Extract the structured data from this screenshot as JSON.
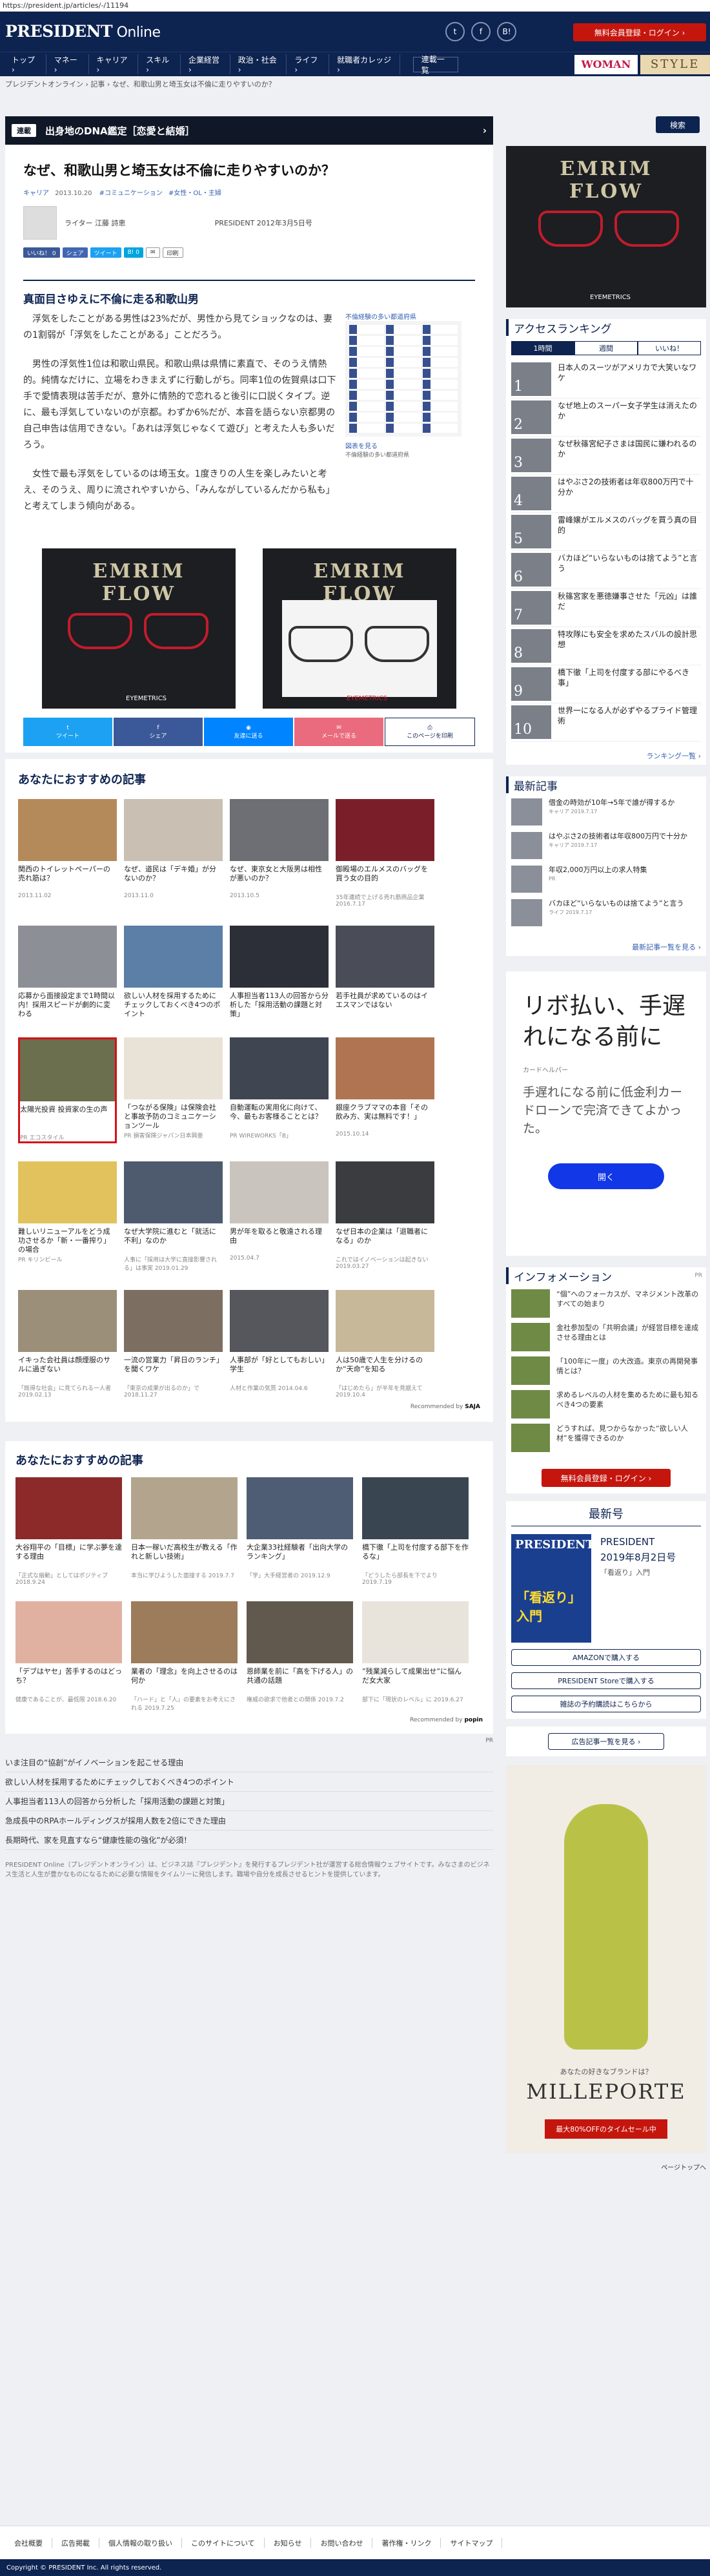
{
  "url": "https://president.jp/articles/-/11194",
  "header": {
    "logo_main": "PRESIDENT",
    "logo_sub": " Online",
    "sns": [
      "t",
      "f",
      "B!"
    ],
    "register": "無料会員登録・ログイン ›"
  },
  "nav": {
    "items": [
      "トップ ›",
      "マネー ›",
      "キャリア ›",
      "スキル ›",
      "企業経営 ›",
      "政治・社会 ›",
      "ライフ ›",
      "就職者カレッジ ›",
      "連載一覧"
    ],
    "brand_woman": "WOMAN",
    "brand_style": "STYLE"
  },
  "breadcrumb": "プレジデントオンライン ›  記事 › なぜ、和歌山男と埼玉女は不倫に走りやすいのか？",
  "series": {
    "tag": "連載",
    "title": "出身地のDNA鑑定［恋愛と結婚］"
  },
  "article": {
    "title": "なぜ、和歌山男と埼玉女は不倫に走りやすいのか？",
    "tags": [
      "キャリア",
      "2013.10.20",
      "#コミュニケーション",
      "#女性・OL・主婦"
    ],
    "author": "ライター 江藤 詩恵",
    "source": "PRESIDENT 2012年3月5日号",
    "share_buttons": [
      "いいね！ 0",
      "シェア",
      "ツイート",
      "B! 0",
      "印刷"
    ],
    "heading": "真面目さゆえに不倫に走る和歌山男",
    "paragraphs": [
      "浮気をしたことがある男性は23%だが、男性から見てショックなのは、妻の1割弱が「浮気をしたことがある」ことだろう。",
      "男性の浮気性1位は和歌山県民。和歌山県は県情に素直で、そのうえ情熱的。純情なだけに、立場をわきまえずに行動しがち。同率1位の佐賀県は口下手で愛情表現は苦手だが、意外に情熱的で恋れると後引に口説くタイプ。逆に、最も浮気していないのが京都。わずか6%だが、本音を語らない京都男の自己申告は信用できない。「あれは浮気じゃなくて遊び」と考えた人も多いだろう。",
      "女性で最も浮気をしているのは埼玉女。1度きりの人生を楽しみたいと考え、そのうえ、周りに流されやすいから、「みんながしているんだから私も」と考えてしまう傾向がある。"
    ],
    "map_title": "不倫経験の多い都道府県",
    "map_caption": "図表を見る",
    "map_caption2": "不倫経験の多い都道府県",
    "share_bar": [
      "ツイート",
      "シェア",
      "友達に送る",
      "メールで送る",
      "このページを印刷"
    ]
  },
  "ads": {
    "glasses_text": "EMRIM FLOW",
    "glasses_sub": "EYEMETRICS"
  },
  "recommend1": {
    "title": "あなたにおすすめの記事",
    "cards": [
      {
        "t": "関西のトイレットペーパーの売れ筋は？",
        "s": "2013.11.02"
      },
      {
        "t": "なぜ、道民は「デキ婚」が分ないのか？",
        "s": "2013.11.0"
      },
      {
        "t": "なぜ、東京女と大阪男は相性が悪いのか？",
        "s": "2013.10.5"
      },
      {
        "t": "御殿場のエルメスのバッグを買う女の目的",
        "s": "35年連続で上げる売れ筋商品企業 2016.7.17"
      },
      {
        "t": "応募から面接設定まで1時間以内！採用スピードが劇的に変わる",
        "s": ""
      },
      {
        "t": "欲しい人材を採用するためにチェックしておくべき4つのポイント",
        "s": ""
      },
      {
        "t": "人事担当者113人の回答から分析した「採用活動の課題と対策」",
        "s": ""
      },
      {
        "t": "若手社員が求めているのはイエスマンではない",
        "s": ""
      },
      {
        "t": "太陽光投資 投資家の生の声",
        "s": "PR エコスタイル"
      },
      {
        "t": "「つながる保険」は保険会社と事故予防のコミュニケーションツール",
        "s": "PR 損害保険ジャパン日本興亜"
      },
      {
        "t": "自動運転の実用化に向けて、今、最もお客様ることとは？",
        "s": "PR WIREWORKS「B」"
      },
      {
        "t": "銀座クラブママの本音「その飲み方、実は無料です！」",
        "s": "2015.10.14"
      },
      {
        "t": "難しいリニューアルをどう成功させるか「新・一番搾り」の場合",
        "s": "PR キリンビール"
      },
      {
        "t": "なぜ大学院に進むと「就活に不利」なのか",
        "s": "人事に「採用は大学に直接影響される」は事実 2019.01.29"
      },
      {
        "t": "男が年を取ると敬遠される理由",
        "s": "2015.04.7"
      },
      {
        "t": "なぜ日本の企業は「退職者になる」のか",
        "s": "これではイノベーションは起きない 2019.03.27"
      },
      {
        "t": "イキった会社員は顔煙服のサルに過ぎない",
        "s": "「既得な社会」に見てられる一人者 2019.02.13"
      },
      {
        "t": "一流の営業力「昇日のランチ」を聞くワケ",
        "s": "「東京の成果が出るのか」で 2018.11.27"
      },
      {
        "t": "人事部が「好としてもおしい」学生",
        "s": "人材と作業の気質 2014.04.6"
      },
      {
        "t": "人は50歳で人生を分けるのか“天命”を知る",
        "s": "「はじめたら」が半年を見据えて 2019.10.4"
      }
    ],
    "powered": "Recommended by"
  },
  "recommend2": {
    "title": "あなたにおすすめの記事",
    "cards": [
      {
        "t": "大谷翔平の「目標」に学ぶ夢を達する理由",
        "s": "「正式な扇動」としてはポジティブ 2018.9.24"
      },
      {
        "t": "日本一稼いだ高校生が教える「作れと新しい技術」",
        "s": "本当に学びようした面接する 2019.7.7"
      },
      {
        "t": "大企業33社経験者「出向大学のランキング」",
        "s": "「学」大手経営者の 2019.12.9"
      },
      {
        "t": "橋下徹「上司を付度する部下を作るな」",
        "s": "「どうしたら部長を下でより 2019.7.19"
      },
      {
        "t": "「デブはヤセ」苦手するのはどっち？",
        "s": "健康であることが、最低限 2018.6.20"
      },
      {
        "t": "業者の「理念」を向上させるのは何か",
        "s": "「ハード」と「人」の要素をお考えにされる 2019.7.25"
      },
      {
        "t": "恩師業を前に「高を下げる人」の共通の話題",
        "s": "権威の欲求で他者との関係 2019.7.2"
      },
      {
        "t": "”残業減らして成果出せ”に悩んだ女大家",
        "s": "部下に「現状のレベル」に 2019.6.27"
      }
    ],
    "powered": "Recommended by"
  },
  "links": [
    "いま注目の“協創”がイノベーションを起こせる理由",
    "欲しい人材を採用するためにチェックしておくべき4つのポイント",
    "人事担当者113人の回答から分析した「採用活動の課題と対策」",
    "急成長中のRPAホールディングスが採用人数を2倍にできた理由",
    "長期時代、家を見直すなら“健康性能の強化”が必須！"
  ],
  "footer_text": "PRESIDENT Online（プレジデントオンライン）は、ビジネス誌『プレジデント』を発行するプレジデント社が運営する総合情報ウェブサイトです。みなさまのビジネス生活と人生が豊かなものになるために必要な情報をタイムリーに発信します。職場や自分を成長させるヒントを提供しています。",
  "footer_nav": [
    "会社概要",
    "広告掲載",
    "個人情報の取り扱い",
    "このサイトについて",
    "お知らせ",
    "お問い合わせ",
    "著作権・リンク",
    "サイトマップ"
  ],
  "copyright": "Copyright © PRESIDENT Inc. All rights reserved.",
  "pagetop": "ページトップへ",
  "sidebar": {
    "search": "検索",
    "ranking_title": "アクセスランキング",
    "tabs": [
      "1時間",
      "週間",
      "いいね！"
    ],
    "ranking": [
      {
        "n": "1",
        "t": "日本人のスーツがアメリカで大笑いなワケ"
      },
      {
        "n": "2",
        "t": "なぜ地上のスーパー女子学生は消えたのか"
      },
      {
        "n": "3",
        "t": "なぜ秋篠宮紀子さまは国民に嫌われるのか"
      },
      {
        "n": "4",
        "t": "はやぶさ2の技術者は年収800万円で十分か"
      },
      {
        "n": "5",
        "t": "雷峰嬢がエルメスのバッグを買う真の目的"
      },
      {
        "n": "6",
        "t": "バカほど“いらないものは捨てよう”と言う"
      },
      {
        "n": "7",
        "t": "秋篠宮家を悪徳嫌事させた「元凶」は誰だ"
      },
      {
        "n": "8",
        "t": "特攻隊にも安全を求めたスバルの設計思想"
      },
      {
        "n": "9",
        "t": "橋下徹「上司を付度する部にやるべき事」"
      },
      {
        "n": "10",
        "t": "世界一になる人が必ずやるプライド管理術"
      }
    ],
    "ranking_more": "ランキング一覧 ›",
    "latest_title": "最新記事",
    "latest": [
      {
        "t": "借金の時効が10年→5年で誰が得するか",
        "s": "キャリア 2019.7.17"
      },
      {
        "t": "はやぶさ2の技術者は年収800万円で十分か",
        "s": "キャリア 2019.7.17"
      },
      {
        "t": "年収2,000万円以上の求人特集",
        "s": "PR"
      },
      {
        "t": "バカほど“いらないものは捨てよう”と言う",
        "s": "ライフ 2019.7.17"
      }
    ],
    "latest_more": "最新記事一覧を見る ›",
    "loan": {
      "headline": "リボ払い、手遅れになる前に",
      "small": "カードヘルパー",
      "body": "手遅れになる前に低金利カードローンで完済できてよかった。",
      "button": "開く"
    },
    "info_title": "インフォメーション",
    "info_pr": "PR",
    "info": [
      "“個”へのフォーカスが、マネジメント改革のすべての始まり",
      "金社参加型の「共明会議」が経営目標を達成させる理由とは",
      "「100年に一度」の大改造。東京の再開発事情とは？",
      "求めるレベルの人材を集めるために最も知るべき4つの要素",
      "どうすれば、見つからなかった“欲しい人材”を獲得できるのか"
    ],
    "register_btn": "無料会員登録・ログイン ›",
    "issue_title": "最新号",
    "issue": {
      "name": "PRESIDENT",
      "date": "2019年8月2日号",
      "feature": "「看返り」入門",
      "cover_t": "PRESIDENT",
      "cover_f": "「看返り」入門"
    },
    "issue_btns": [
      "AMAZONで購入する",
      "PRESIDENT Storeで購入する",
      "雑誌の予約購読はこちらから"
    ],
    "ad_list": "広告記事一覧を見る ›",
    "ad300": {
      "q": "あなたの好きなブランドは？",
      "brand": "MILLEPORTE",
      "btn": "最大80%OFFのタイムセール中"
    }
  }
}
